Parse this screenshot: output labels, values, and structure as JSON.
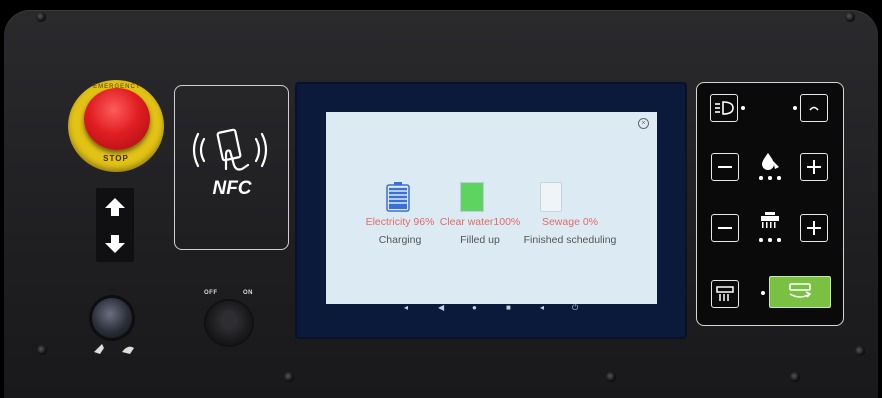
{
  "estop": {
    "ring_text": "EMERGENCY",
    "stop_label": "STOP"
  },
  "nfc": {
    "label": "NFC"
  },
  "key_switch": {
    "off_label": "OFF",
    "on_label": "ON"
  },
  "screen": {
    "electricity": {
      "name": "Electricity",
      "value": "96%",
      "status": "Charging"
    },
    "clear_water": {
      "name": "Clear water",
      "value": "100%",
      "status": "Filled up"
    },
    "sewage": {
      "name": "Sewage",
      "value": "0%",
      "status": "Finished scheduling"
    },
    "levels": {
      "electricity": 0.96,
      "clear_water": 1.0,
      "sewage": 0.0
    }
  },
  "colors": {
    "stat_label": "#e26a6a",
    "water_fill": "#5fd35f",
    "battery": "#3a6fd8",
    "mode_active": "#7ac143",
    "estop": "#e01e22",
    "estop_ring": "#e2c215"
  },
  "icons": {
    "headlight": "headlight-icon",
    "horn": "horn-icon",
    "water_drop": "water-drop-icon",
    "brush": "brush-icon",
    "squeegee": "squeegee-icon",
    "cleaning_mode": "cleaning-mode-icon"
  }
}
